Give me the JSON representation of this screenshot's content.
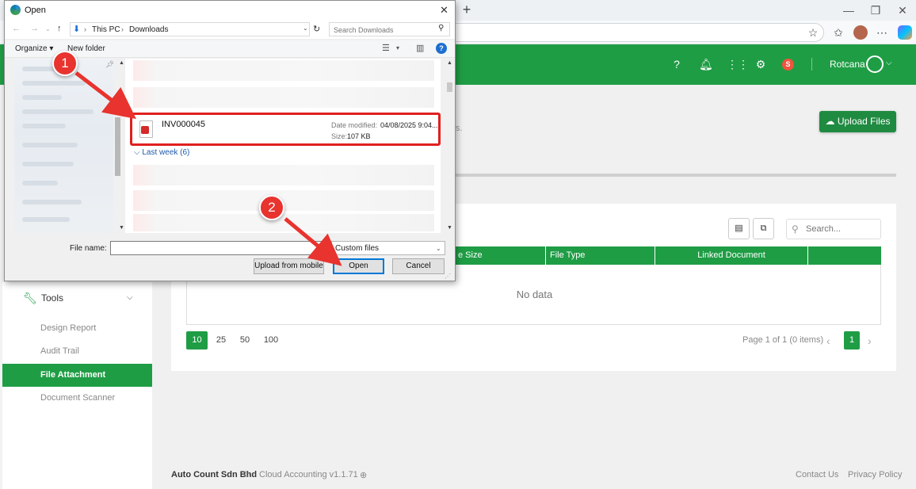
{
  "browser": {
    "new_tab": "+",
    "minimize": "—",
    "restore": "❐",
    "close": "✕"
  },
  "header": {
    "user_name": "Rotcana",
    "badge_letter": "S"
  },
  "page": {
    "upload_button": "Upload Files",
    "hint_suffix": "s.",
    "search_placeholder": "Search...",
    "columns": [
      "e Size",
      "File Type",
      "Linked Document",
      ""
    ],
    "no_data": "No data",
    "page_sizes": [
      "10",
      "25",
      "50",
      "100"
    ],
    "active_page_size": "10",
    "pager_info": "Page 1 of 1 (0 items)",
    "current_page": "1"
  },
  "sidebar": {
    "section": "Tools",
    "items": [
      "Design Report",
      "Audit Trail",
      "File Attachment",
      "Document Scanner"
    ],
    "active": "File Attachment"
  },
  "footer": {
    "company": "Auto Count Sdn Bhd",
    "copyright": "©",
    "product": "Cloud Accounting v1.1.71",
    "links": [
      "Contact Us",
      "Privacy Policy"
    ]
  },
  "dialog": {
    "title": "Open",
    "breadcrumb": [
      "This PC",
      "Downloads"
    ],
    "search_placeholder": "Search Downloads",
    "toolbar": {
      "organize": "Organize ▾",
      "new_folder": "New folder"
    },
    "selected_file": {
      "name": "INV000045",
      "date_label": "Date modified:",
      "date_value": "04/08/2025 9:04...",
      "size_label": "Size:",
      "size_value": "107 KB"
    },
    "group_header": "Last week (6)",
    "file_name_label": "File name:",
    "file_name_value": "",
    "file_type": "Custom files",
    "buttons": {
      "upload_mobile": "Upload from mobile",
      "open": "Open",
      "cancel": "Cancel"
    }
  },
  "callouts": [
    "1",
    "2"
  ],
  "colors": {
    "brand_green": "#1f9d45",
    "callout_red": "#e8332e"
  }
}
